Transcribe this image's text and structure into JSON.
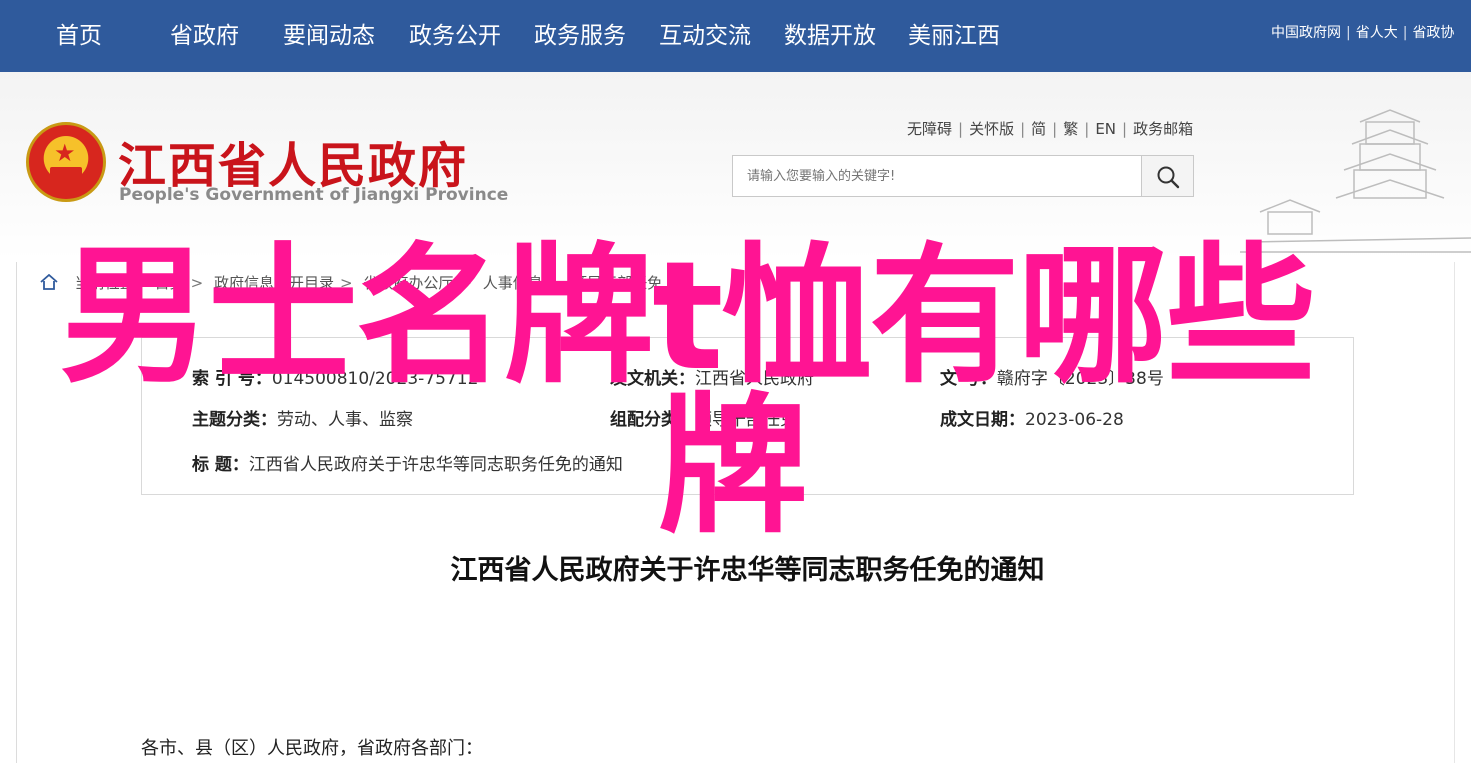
{
  "topnav": {
    "items": [
      "首页",
      "省政府",
      "要闻动态",
      "政务公开",
      "政务服务",
      "互动交流",
      "数据开放",
      "美丽江西"
    ],
    "links": [
      "中国政府网",
      "省人大",
      "省政协"
    ]
  },
  "header": {
    "title": "江西省人民政府",
    "subtitle": "People's Government of Jiangxi Province",
    "util_links": [
      "无障碍",
      "关怀版",
      "简",
      "繁",
      "EN",
      "政务邮箱"
    ],
    "search_placeholder": "请输入您要输入的关键字!"
  },
  "breadcrumb": {
    "items": [
      "当前位置：",
      "首页",
      "政府信息公开目录",
      "省政府办公厅",
      "人事信息",
      "领导干部任免"
    ]
  },
  "meta": {
    "index_label": "索 引 号：",
    "index_value": "014500810/2023-75712",
    "issuer_label": "发文机关：",
    "issuer_value": "江西省人民政府",
    "docno_label": "文 号：",
    "docno_value": "赣府字〔2023〕38号",
    "topic_label": "主题分类：",
    "topic_value": "劳动、人事、监察",
    "genre_label": "组配分类：",
    "genre_value": "领导干部任免",
    "date_label": "成文日期：",
    "date_value": "2023-06-28",
    "title_label": "标 题：",
    "title_value": "江西省人民政府关于许忠华等同志职务任免的通知"
  },
  "document": {
    "title": "江西省人民政府关于许忠华等同志职务任免的通知",
    "salutation": "各市、县（区）人民政府，省政府各部门："
  },
  "overlay": {
    "line1": "男士名牌t恤有哪些",
    "line2": "牌"
  },
  "colors": {
    "nav_bg": "#2f5a9c",
    "brand_red": "#c9141b",
    "overlay_pink": "#ff1493"
  }
}
